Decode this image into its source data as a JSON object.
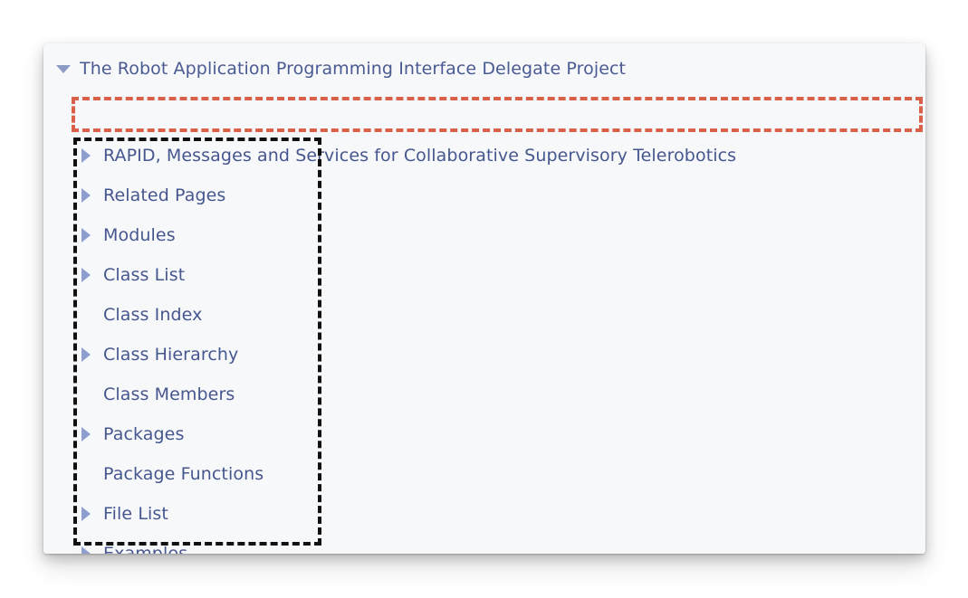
{
  "page": {
    "background_color": "#ffffff"
  },
  "panel": {
    "background_color": "#f7f8fa",
    "name": "documentation-navigation-panel"
  },
  "tree": {
    "root": {
      "label": "The Robot Application Programming Interface Delegate Project",
      "twisty": "triangle-down-icon",
      "expanded": true
    },
    "items": [
      {
        "label": "RAPID, Messages and Services for Collaborative Supervisory Telerobotics",
        "twisty": "triangle-right-icon",
        "expanded": false
      },
      {
        "label": "Related Pages",
        "twisty": "triangle-right-icon",
        "expanded": false
      },
      {
        "label": "Modules",
        "twisty": "triangle-right-icon",
        "expanded": false
      },
      {
        "label": "Class List",
        "twisty": "triangle-right-icon",
        "expanded": false
      },
      {
        "label": "Class Index",
        "twisty": "none",
        "expanded": false
      },
      {
        "label": "Class Hierarchy",
        "twisty": "triangle-right-icon",
        "expanded": false
      },
      {
        "label": "Class Members",
        "twisty": "none",
        "expanded": false
      },
      {
        "label": "Packages",
        "twisty": "triangle-right-icon",
        "expanded": false
      },
      {
        "label": "Package Functions",
        "twisty": "none",
        "expanded": false
      },
      {
        "label": "File List",
        "twisty": "triangle-right-icon",
        "expanded": false
      },
      {
        "label": "Examples",
        "twisty": "triangle-right-icon",
        "expanded": false
      }
    ]
  },
  "annotations": {
    "red_box": {
      "name": "red-dashed-highlight-box",
      "color": "#d9614a",
      "style": "dashed",
      "targets": "RAPID, Messages and Services for Collaborative Supervisory Telerobotics"
    },
    "black_box": {
      "name": "black-dashed-highlight-box",
      "color": "#111111",
      "style": "dashed",
      "targets": "Related Pages through Examples"
    }
  },
  "colors": {
    "link_text": "#46568e",
    "twisty_open": "#8c9bc4",
    "twisty_closed": "#8e9ece"
  }
}
